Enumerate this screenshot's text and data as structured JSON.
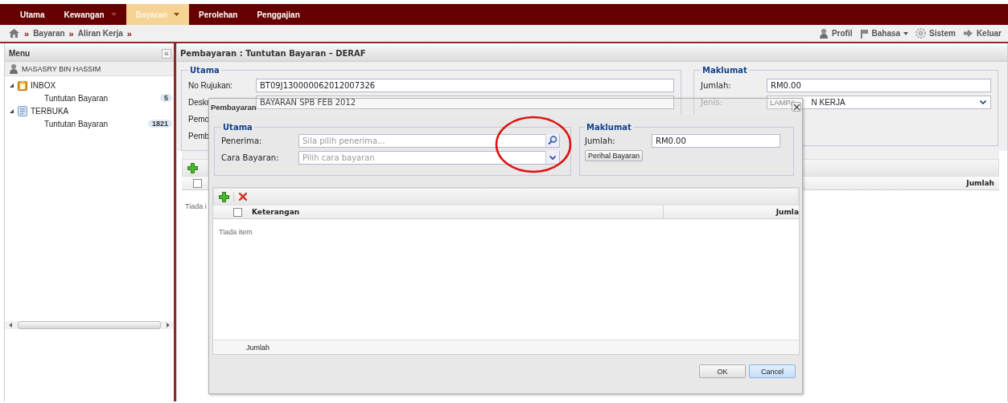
{
  "nav": {
    "items": [
      {
        "label": "Utama",
        "selected": false,
        "dropdown": false
      },
      {
        "label": "Kewangan",
        "selected": false,
        "dropdown": true
      },
      {
        "label": "Bayaran",
        "selected": true,
        "dropdown": true
      },
      {
        "label": "Perolehan",
        "selected": false,
        "dropdown": false
      },
      {
        "label": "Penggajian",
        "selected": false,
        "dropdown": false
      }
    ]
  },
  "breadcrumb": {
    "separator": "»",
    "items": [
      "Bayaran",
      "Aliran Kerja"
    ]
  },
  "top_links": [
    {
      "label": "Profil",
      "kind": "user",
      "dropdown": false
    },
    {
      "label": "Bahasa",
      "kind": "flag",
      "dropdown": true
    },
    {
      "label": "Sistem",
      "kind": "gear",
      "dropdown": false
    },
    {
      "label": "Keluar",
      "kind": "exit",
      "dropdown": false
    }
  ],
  "sidebar": {
    "title": "Menu",
    "collapse": "«",
    "user": "MASASRY BIN HASSIM",
    "tree": [
      {
        "label": "INBOX",
        "kind": "inbox",
        "expanded": true,
        "children": [
          {
            "label": "Tuntutan Bayaran",
            "count": "5"
          }
        ]
      },
      {
        "label": "TERBUKA",
        "kind": "open",
        "expanded": true,
        "children": [
          {
            "label": "Tuntutan Bayaran",
            "count": "1821"
          }
        ]
      }
    ]
  },
  "main": {
    "title": "Pembayaran : Tuntutan Bayaran – DERAF",
    "utama": {
      "legend": "Utama",
      "fields": [
        {
          "label": "No Rujukan:",
          "value": "BT09J130000062012007326"
        },
        {
          "label": "Deskr",
          "value": "BAYARAN SPB FEB 2012"
        },
        {
          "label": "Pemo"
        },
        {
          "label": "Pemb"
        }
      ]
    },
    "maklumat": {
      "legend": "Maklumat",
      "jumlah": {
        "label": "Jumlah:",
        "value": "RM0.00"
      },
      "jenis": {
        "label": "Jenis:",
        "value_parts": [
          "LAMPA",
          "N KERJA"
        ]
      }
    },
    "grid": {
      "header_checkbox": {
        "checked": false
      },
      "columns": [
        "Jumlah"
      ],
      "empty_text": "Tiada i"
    }
  },
  "dialog": {
    "title": "Pembayaran",
    "utama": {
      "legend": "Utama",
      "fields": [
        {
          "label": "Penerima:",
          "placeholder": "Sila pilih penerima...",
          "kind": "search"
        },
        {
          "label": "Cara Bayaran:",
          "placeholder": "Pilih cara bayaran",
          "kind": "select"
        }
      ]
    },
    "maklumat": {
      "legend": "Maklumat",
      "field": {
        "label": "Jumlah:",
        "value": "RM0.00"
      },
      "button": "Perihal Bayaran"
    },
    "grid": {
      "header_checkbox": {
        "checked": false
      },
      "columns": [
        "Keterangan",
        "Jumla"
      ],
      "empty_text": "Tiada item",
      "footer": "Jumlah"
    },
    "buttons": [
      {
        "label": "OK",
        "selected": false
      },
      {
        "label": "Cancel",
        "selected": true
      }
    ]
  }
}
